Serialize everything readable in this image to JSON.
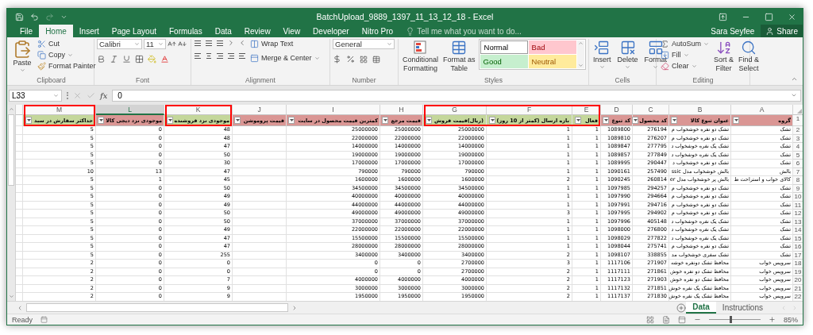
{
  "window": {
    "title": "BatchUpload_9889_1397_11_13_12_18 - Excel",
    "user": "Sara Seyfee",
    "share": "Share"
  },
  "tabs": [
    {
      "label": "File",
      "selected": false
    },
    {
      "label": "Home",
      "selected": true
    },
    {
      "label": "Insert",
      "selected": false
    },
    {
      "label": "Page Layout",
      "selected": false
    },
    {
      "label": "Formulas",
      "selected": false
    },
    {
      "label": "Data",
      "selected": false
    },
    {
      "label": "Review",
      "selected": false
    },
    {
      "label": "View",
      "selected": false
    },
    {
      "label": "Developer",
      "selected": false
    },
    {
      "label": "Nitro Pro",
      "selected": false
    }
  ],
  "tell_me": {
    "placeholder": "Tell me what you want to do..."
  },
  "ribbon": {
    "clipboard": {
      "label": "Clipboard",
      "paste": "Paste",
      "cut": "Cut",
      "copy": "Copy",
      "format_painter": "Format Painter"
    },
    "font": {
      "label": "Font",
      "name": "Calibri",
      "size": "11"
    },
    "alignment": {
      "label": "Alignment",
      "wrap_text": "Wrap Text",
      "merge": "Merge & Center"
    },
    "number": {
      "label": "Number",
      "format": "General"
    },
    "styles": {
      "label": "Styles",
      "conditional": [
        "Conditional",
        "Formatting"
      ],
      "format_table": [
        "Format as",
        "Table"
      ],
      "gallery": [
        {
          "name": "Normal",
          "kind": "normal"
        },
        {
          "name": "Bad",
          "kind": "bad"
        },
        {
          "name": "Good",
          "kind": "good"
        },
        {
          "name": "Neutral",
          "kind": "neutral"
        }
      ]
    },
    "cells": {
      "label": "Cells",
      "buttons": [
        {
          "label": "Insert",
          "kind": "insert"
        },
        {
          "label": "Delete",
          "kind": "delete"
        },
        {
          "label": "Format",
          "kind": "format"
        }
      ]
    },
    "editing": {
      "label": "Editing",
      "autosum": "AutoSum",
      "fill": "Fill",
      "clear": "Clear",
      "sort": [
        "Sort &",
        "Filter"
      ],
      "find": [
        "Find &",
        "Select"
      ]
    }
  },
  "formula_bar": {
    "name_box": "L33",
    "fx": "fx",
    "value": "0"
  },
  "sheet": {
    "columns": [
      {
        "letter": "M",
        "header": "حداکثر سفارش در سبد",
        "color": "#c4d79b",
        "boxed": true,
        "selected": false
      },
      {
        "letter": "L",
        "header": "موجودی نزد دیجی کالا",
        "color": "#da9694",
        "boxed": false,
        "selected": true
      },
      {
        "letter": "K",
        "header": "موجودی نزد فروشنده",
        "color": "#c4d79b",
        "boxed": true,
        "selected": false
      },
      {
        "letter": "J",
        "header": "قیمت پروموشن",
        "color": "#da9694",
        "boxed": false,
        "selected": false
      },
      {
        "letter": "I",
        "header": "کمترین قیمت محصول در سایت",
        "color": "#da9694",
        "boxed": false,
        "selected": false
      },
      {
        "letter": "H",
        "header": "قیمت مرجع",
        "color": "#da9694",
        "boxed": false,
        "selected": false
      },
      {
        "letter": "G",
        "header": "(ریال)قیمت فروش",
        "color": "#c4d79b",
        "boxed": true,
        "selected": false
      },
      {
        "letter": "F",
        "header": "بازه ارسال (کمتر از 10 روز)",
        "color": "#c4d79b",
        "boxed": true,
        "selected": false
      },
      {
        "letter": "E",
        "header": "فعال",
        "color": "#c4d79b",
        "boxed": true,
        "selected": false
      },
      {
        "letter": "D",
        "header": "کد تنوع",
        "color": "#da9694",
        "boxed": false,
        "selected": false
      },
      {
        "letter": "C",
        "header": "کد محصول",
        "color": "#da9694",
        "boxed": false,
        "selected": false
      },
      {
        "letter": "B",
        "header": "عنوان تنوع کالا",
        "color": "#da9694",
        "boxed": false,
        "selected": false
      },
      {
        "letter": "A",
        "header": "گروه",
        "color": "#da9694",
        "boxed": false,
        "selected": false
      }
    ],
    "header_row": "1",
    "rows": [
      {
        "number": "2",
        "cells": [
          "5",
          "0",
          "48",
          null,
          "25000000",
          "25000000",
          "25000000",
          "1",
          "1",
          "1089800",
          "276194",
          "تشک دو نفره خوشخواب م",
          "تشک"
        ]
      },
      {
        "number": "3",
        "cells": [
          "5",
          "0",
          "48",
          null,
          "22000000",
          "22000000",
          "22000000",
          "1",
          "1",
          "1089810",
          "276207",
          "تشک دو نفره خوشخواب م",
          "تشک"
        ]
      },
      {
        "number": "4",
        "cells": [
          "5",
          "0",
          "47",
          null,
          "14000000",
          "14000000",
          "14000000",
          "1",
          "1",
          "1089847",
          "277795",
          "تشک یک نفره خوشخواب د",
          "تشک"
        ]
      },
      {
        "number": "5",
        "cells": [
          "5",
          "0",
          "50",
          null,
          "19000000",
          "19000000",
          "19000000",
          "1",
          "1",
          "1089857",
          "277849",
          "تشک یک نفره خوشخواب د",
          "تشک"
        ]
      },
      {
        "number": "6",
        "cells": [
          "5",
          "0",
          "30",
          null,
          "17000000",
          "17000000",
          "17000000",
          "1",
          "1",
          "1089995",
          "290447",
          "تشک دو نفره خوشخواب د",
          "تشک"
        ]
      },
      {
        "number": "7",
        "cells": [
          "10",
          "13",
          "47",
          null,
          "790000",
          "790000",
          "790000",
          "1",
          "1",
          "1090161",
          "257490",
          "بالش خوشخواب مدل ssic",
          "بالش"
        ]
      },
      {
        "number": "8",
        "cells": [
          "5",
          "1",
          "45",
          null,
          "1600000",
          "1600000",
          "1600000",
          "2",
          "1",
          "1090245",
          "260814",
          "بالش پر خوشخواب مدل er",
          "کالای خواب و استراحت ط"
        ]
      },
      {
        "number": "9",
        "cells": [
          "5",
          "0",
          "50",
          null,
          "34500000",
          "34500000",
          "34500000",
          "1",
          "1",
          "1097985",
          "294257",
          "تشک دو نفره خوشخواب م",
          "تشک"
        ]
      },
      {
        "number": "10",
        "cells": [
          "5",
          "0",
          "49",
          null,
          "40000000",
          "40000000",
          "40000000",
          "1",
          "1",
          "1097990",
          "294664",
          "تشک دو نفره خوشخواب م",
          "تشک"
        ]
      },
      {
        "number": "11",
        "cells": [
          "5",
          "0",
          "49",
          null,
          "44000000",
          "44000000",
          "44000000",
          "1",
          "1",
          "1097991",
          "294716",
          "تشک دو نفره خوشخواب م",
          "تشک"
        ]
      },
      {
        "number": "12",
        "cells": [
          "5",
          "0",
          "50",
          null,
          "49000000",
          "49000000",
          "49000000",
          "3",
          "1",
          "1097995",
          "294902",
          "تشک دو نفره خوشخواب م",
          "تشک"
        ]
      },
      {
        "number": "13",
        "cells": [
          "5",
          "0",
          "50",
          null,
          "37000000",
          "37000000",
          "37000000",
          "1",
          "1",
          "1097996",
          "405148",
          "تشک یک نفره خوشخواب د",
          "تشک"
        ]
      },
      {
        "number": "14",
        "cells": [
          "5",
          "0",
          "49",
          null,
          "22000000",
          "22000000",
          "22000000",
          "1",
          "1",
          "1098000",
          "276800",
          "تشک یک نفره خوشخواب د",
          "تشک"
        ]
      },
      {
        "number": "15",
        "cells": [
          "5",
          "0",
          "47",
          null,
          "15500000",
          "15500000",
          "15500000",
          "1",
          "1",
          "1098029",
          "277822",
          "تشک یک نفره خوشخواب د",
          "تشک"
        ]
      },
      {
        "number": "16",
        "cells": [
          "5",
          "0",
          "47",
          null,
          "28000000",
          "28000000",
          "28000000",
          "1",
          "1",
          "1098044",
          "275741",
          "تشک دو نفره خوشخواب م",
          "تشک"
        ]
      },
      {
        "number": "17",
        "cells": [
          "5",
          "0",
          "255",
          null,
          "3400000",
          "3400000",
          "3400000",
          "2",
          "1",
          "1098107",
          "338855",
          "تشک سفری خوشخواب مد",
          "تشک"
        ]
      },
      {
        "number": "18",
        "cells": [
          "2",
          "0",
          "0",
          null,
          "0",
          "0",
          "2700000",
          "3",
          "1",
          "1117106",
          "271907",
          "محافظ تشک دونفره خوشه",
          "سرویس خواب"
        ]
      },
      {
        "number": "19",
        "cells": [
          "2",
          "0",
          "0",
          null,
          "0",
          "0",
          "2700000",
          "2",
          "1",
          "1117111",
          "271861",
          "محافظ تشک دو نفره خوش",
          "سرویس خواب"
        ]
      },
      {
        "number": "20",
        "cells": [
          "2",
          "0",
          "7",
          null,
          "4000000",
          "4000000",
          "4000000",
          "2",
          "1",
          "1117123",
          "271903",
          "محافظ تشک دو نفره خوش",
          "سرویس خواب"
        ]
      },
      {
        "number": "21",
        "cells": [
          "2",
          "0",
          "9",
          null,
          "3000000",
          "3000000",
          "3000000",
          "2",
          "1",
          "1117132",
          "271851",
          "محافظ تشک یک نفره خوش",
          "سرویس خواب"
        ]
      },
      {
        "number": "22",
        "cells": [
          "2",
          "0",
          "9",
          null,
          "1950000",
          "1950000",
          "1950000",
          "2",
          "1",
          "1117137",
          "271830",
          "محافظ تشک یک نفره خوش",
          "سرویس خواب"
        ]
      }
    ]
  },
  "sheet_tabs": [
    {
      "label": "Data",
      "selected": true
    },
    {
      "label": "Instructions",
      "selected": false
    }
  ],
  "status_bar": {
    "status": "Ready",
    "zoom": "85%",
    "zoom_slider": {
      "level": 0.42
    }
  }
}
